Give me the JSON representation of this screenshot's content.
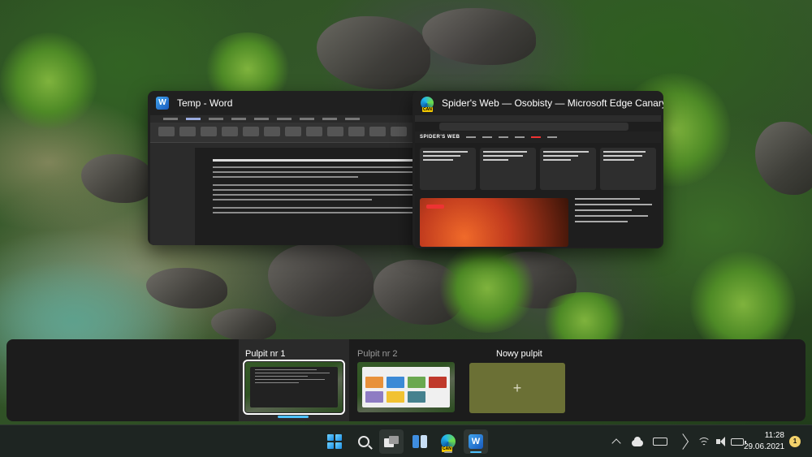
{
  "windows": [
    {
      "title": "Temp - Word",
      "icon": "word-icon"
    },
    {
      "title": "Spider's Web — Osobisty — Microsoft Edge Canary",
      "icon": "edge-canary-icon"
    }
  ],
  "edge_preview": {
    "site_name": "SPIDER'S WEB"
  },
  "desktops": {
    "items": [
      {
        "label": "Pulpit nr 1",
        "active": true
      },
      {
        "label": "Pulpit nr 2",
        "active": false
      }
    ],
    "new_desktop_label": "Nowy pulpit",
    "new_desktop_symbol": "+"
  },
  "taskbar": {
    "apps": [
      "start-icon",
      "search-icon",
      "task-view-icon",
      "widgets-icon",
      "edge-canary-icon",
      "word-icon"
    ],
    "edge_badge": "CAN",
    "word_letter": "W",
    "tray": [
      "chevron-up-icon",
      "onedrive-icon",
      "keyboard-icon",
      "location-icon",
      "wifi-icon",
      "volume-icon",
      "battery-icon"
    ],
    "time": "11:28",
    "date": "29.06.2021",
    "notification_count": "1"
  },
  "colors": {
    "accent": "#4cc2ff",
    "taskbar_bg": "#1e2522",
    "strip_bg": "#1c1c1c",
    "new_desktop_bg": "#6b7035"
  }
}
